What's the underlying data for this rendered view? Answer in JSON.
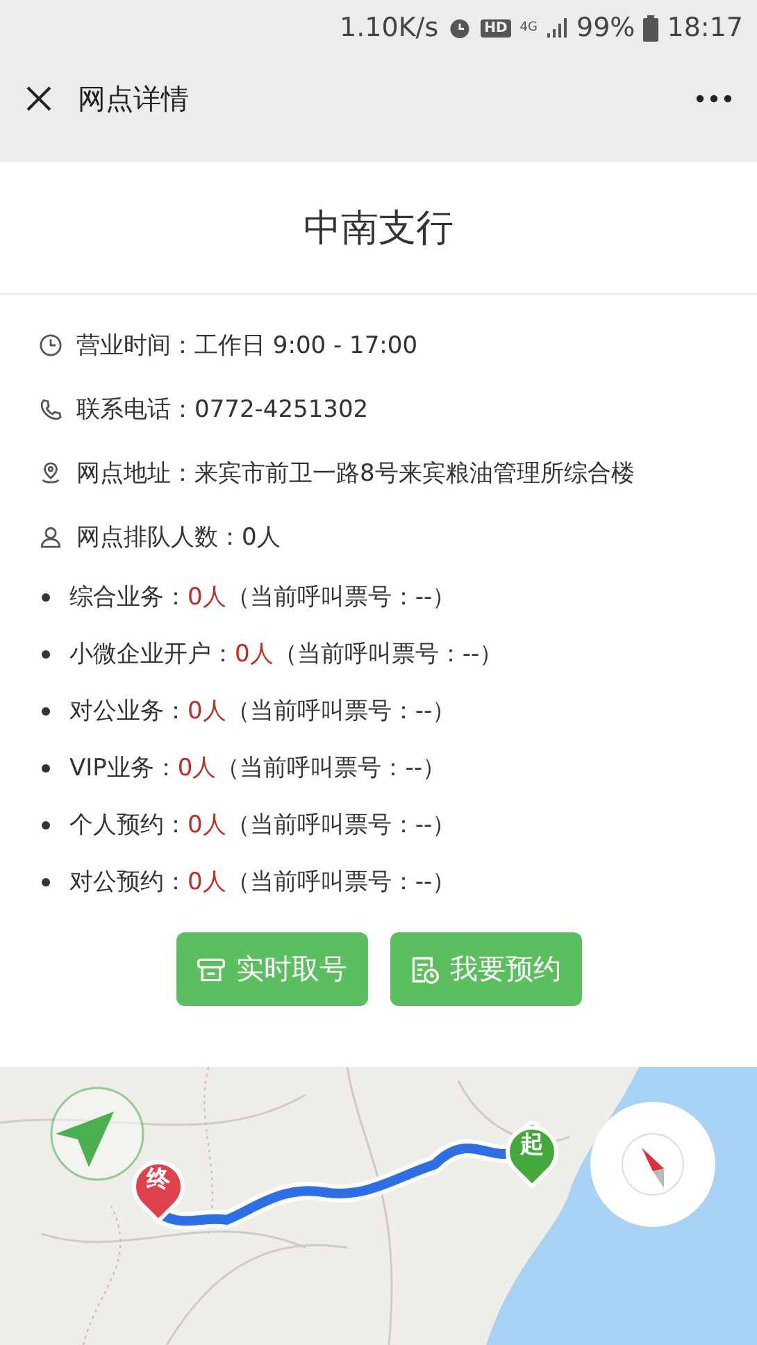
{
  "status_bar": {
    "network_speed": "1.10K/s",
    "hd_badge": "HD",
    "network": "4G",
    "battery": "99%",
    "time": "18:17"
  },
  "nav_bar": {
    "title": "网点详情"
  },
  "branch": {
    "name": "中南支行",
    "info": [
      {
        "kind": "hours",
        "text": "营业时间：工作日 9:00 - 17:00"
      },
      {
        "kind": "phone",
        "text": "联系电话：0772-4251302"
      },
      {
        "kind": "address",
        "text": "网点地址：来宾市前卫一路8号来宾粮油管理所综合楼"
      },
      {
        "kind": "queue",
        "text": "网点排队人数：0人"
      }
    ],
    "queues": [
      {
        "label": "综合业务：",
        "count": "0人",
        "ticket": "（当前呼叫票号：--）"
      },
      {
        "label": "小微企业开户：",
        "count": "0人",
        "ticket": "（当前呼叫票号：--）"
      },
      {
        "label": "对公业务：",
        "count": "0人",
        "ticket": "（当前呼叫票号：--）"
      },
      {
        "label": "VIP业务：",
        "count": "0人",
        "ticket": "（当前呼叫票号：--）"
      },
      {
        "label": "个人预约：",
        "count": "0人",
        "ticket": "（当前呼叫票号：--）"
      },
      {
        "label": "对公预约：",
        "count": "0人",
        "ticket": "（当前呼叫票号：--）"
      }
    ],
    "actions": [
      {
        "kind": "ticket",
        "label": "实时取号"
      },
      {
        "kind": "reservation",
        "label": "我要预约"
      }
    ]
  },
  "map": {
    "kind": "picture",
    "markers": [
      {
        "kind": "start",
        "label": "起"
      },
      {
        "kind": "end",
        "label": "终"
      }
    ]
  }
}
